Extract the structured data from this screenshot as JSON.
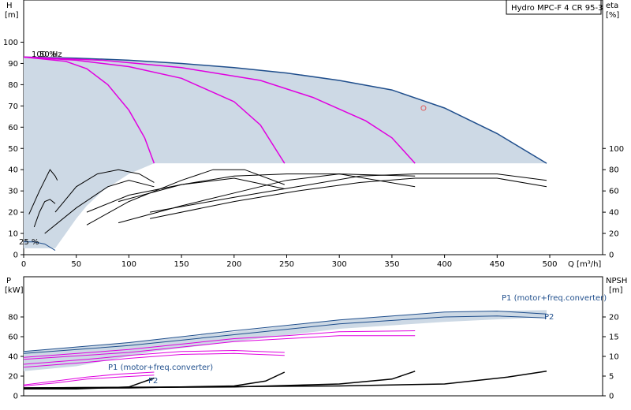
{
  "title": "Hydro MPC-F 4 CR 95-3",
  "chart_data": [
    {
      "type": "line",
      "panel": "head",
      "title": "Hydro MPC-F 4 CR 95-3",
      "x_axis": {
        "label": "Q [m³/h]",
        "range": [
          0,
          520
        ],
        "ticks": [
          0,
          50,
          100,
          150,
          200,
          250,
          300,
          350,
          400,
          450,
          500
        ]
      },
      "y_left": {
        "label_unit": "H",
        "label_bracket": "[m]",
        "range": [
          0,
          110
        ],
        "ticks": [
          0,
          10,
          20,
          30,
          40,
          50,
          60,
          70,
          80,
          90,
          100
        ]
      },
      "y_right": {
        "label_unit": "eta",
        "label_bracket": "[%]",
        "range_units": "eta %",
        "ticks": [
          0,
          20,
          40,
          60,
          80,
          100
        ],
        "eta_to_head_scale": 0.5
      },
      "annotations": {
        "speed_label": "100 %",
        "freq_label": "50 Hz",
        "min_speed_label": "25 %"
      },
      "operating_point": {
        "q": 380,
        "h": 69
      },
      "shaded_region": {
        "outline": [
          [
            0,
            93
          ],
          [
            50,
            92.5
          ],
          [
            100,
            91.5
          ],
          [
            150,
            90
          ],
          [
            200,
            88
          ],
          [
            250,
            85.5
          ],
          [
            300,
            82
          ],
          [
            350,
            77.5
          ],
          [
            400,
            69
          ],
          [
            450,
            57
          ],
          [
            497,
            43
          ],
          [
            497,
            43
          ],
          [
            200,
            43
          ],
          [
            124,
            43
          ],
          [
            100,
            38
          ],
          [
            75,
            30
          ],
          [
            60,
            23
          ],
          [
            50,
            17
          ],
          [
            40,
            10
          ],
          [
            30,
            3
          ],
          [
            0,
            3
          ],
          [
            0,
            93
          ]
        ],
        "color": "#cdd9e5"
      },
      "head_curves": [
        {
          "color": "#1f4e8c",
          "points": [
            [
              0,
              93
            ],
            [
              50,
              92.5
            ],
            [
              100,
              91.5
            ],
            [
              150,
              90
            ],
            [
              200,
              88
            ],
            [
              250,
              85.5
            ],
            [
              300,
              82
            ],
            [
              350,
              77.5
            ],
            [
              400,
              69
            ],
            [
              450,
              57
            ],
            [
              497,
              43
            ]
          ]
        },
        {
          "color": "#e000e0",
          "points": [
            [
              0,
              93
            ],
            [
              40,
              91
            ],
            [
              60,
              87.5
            ],
            [
              80,
              80
            ],
            [
              100,
              68
            ],
            [
              115,
              55
            ],
            [
              124,
              43
            ]
          ]
        },
        {
          "color": "#e000e0",
          "points": [
            [
              0,
              93
            ],
            [
              50,
              91.5
            ],
            [
              100,
              88.5
            ],
            [
              150,
              83
            ],
            [
              200,
              72
            ],
            [
              225,
              61
            ],
            [
              248,
              43
            ]
          ]
        },
        {
          "color": "#e000e0",
          "points": [
            [
              0,
              93
            ],
            [
              75,
              91.5
            ],
            [
              150,
              88
            ],
            [
              225,
              82
            ],
            [
              275,
              74
            ],
            [
              325,
              63
            ],
            [
              350,
              55
            ],
            [
              372,
              43
            ]
          ]
        }
      ],
      "eta_curves": [
        {
          "color": "#000000",
          "points": [
            [
              5,
              19
            ],
            [
              15,
              30
            ],
            [
              20,
              35
            ],
            [
              25,
              40
            ],
            [
              30,
              37
            ],
            [
              32,
              35
            ]
          ]
        },
        {
          "color": "#000000",
          "points": [
            [
              10,
              13
            ],
            [
              15,
              20
            ],
            [
              20,
              25
            ],
            [
              25,
              26
            ],
            [
              30,
              24
            ]
          ]
        },
        {
          "color": "#000000",
          "points": [
            [
              30,
              20
            ],
            [
              50,
              32
            ],
            [
              70,
              38
            ],
            [
              90,
              40
            ],
            [
              110,
              38
            ],
            [
              124,
              34
            ]
          ]
        },
        {
          "color": "#000000",
          "points": [
            [
              20,
              10
            ],
            [
              50,
              22
            ],
            [
              80,
              32
            ],
            [
              100,
              35
            ],
            [
              124,
              32
            ]
          ]
        },
        {
          "color": "#000000",
          "points": [
            [
              60,
              14
            ],
            [
              100,
              25
            ],
            [
              150,
              35
            ],
            [
              180,
              40
            ],
            [
              210,
              40
            ],
            [
              248,
              33
            ]
          ]
        },
        {
          "color": "#000000",
          "points": [
            [
              60,
              20
            ],
            [
              100,
              28
            ],
            [
              150,
              33
            ],
            [
              200,
              36
            ],
            [
              248,
              31
            ]
          ]
        },
        {
          "color": "#000000",
          "points": [
            [
              90,
              15
            ],
            [
              150,
              23
            ],
            [
              200,
              29
            ],
            [
              250,
              35
            ],
            [
              300,
              38
            ],
            [
              372,
              37
            ]
          ]
        },
        {
          "color": "#000000",
          "points": [
            [
              90,
              25
            ],
            [
              150,
              33
            ],
            [
              200,
              37
            ],
            [
              250,
              38
            ],
            [
              300,
              38
            ],
            [
              372,
              32
            ]
          ]
        },
        {
          "color": "#000000",
          "points": [
            [
              120,
              20
            ],
            [
              200,
              27
            ],
            [
              260,
              32
            ],
            [
              320,
              37
            ],
            [
              372,
              38
            ],
            [
              450,
              38
            ],
            [
              497,
              35
            ]
          ]
        },
        {
          "color": "#000000",
          "points": [
            [
              120,
              17
            ],
            [
              200,
              25
            ],
            [
              260,
              30
            ],
            [
              320,
              34
            ],
            [
              372,
              36
            ],
            [
              450,
              36
            ],
            [
              497,
              32
            ]
          ]
        }
      ],
      "min_curve": {
        "color": "#1f4e8c",
        "points": [
          [
            0,
            6
          ],
          [
            10,
            6
          ],
          [
            20,
            5
          ],
          [
            30,
            2
          ]
        ]
      }
    },
    {
      "type": "line",
      "panel": "power_npsh",
      "x_axis": {
        "range": [
          0,
          520
        ]
      },
      "y_left": {
        "label_unit": "P",
        "label_bracket": "[kW]",
        "range": [
          0,
          100
        ],
        "ticks": [
          0,
          20,
          40,
          60,
          80
        ]
      },
      "y_right": {
        "label_unit": "NPSH",
        "label_bracket": "[m]",
        "ticks": [
          0,
          5,
          10,
          15,
          20
        ],
        "npsh_to_kw_scale": 4
      },
      "labels": {
        "p1_high": "P1 (motor+freq.converter)",
        "p2_high": "P2",
        "p1_low": "P1 (motor+freq.converter)",
        "p2_low": "P2"
      },
      "shaded_region": {
        "outline": [
          [
            0,
            45
          ],
          [
            100,
            54
          ],
          [
            200,
            65
          ],
          [
            300,
            77
          ],
          [
            400,
            85
          ],
          [
            497,
            87
          ],
          [
            497,
            80
          ],
          [
            400,
            75
          ],
          [
            300,
            68
          ],
          [
            200,
            55
          ],
          [
            124,
            45
          ],
          [
            100,
            40
          ],
          [
            50,
            30
          ],
          [
            0,
            25
          ]
        ],
        "color": "#cdd9e5"
      },
      "power_curves": [
        {
          "color": "#1f4e8c",
          "points": [
            [
              0,
              45
            ],
            [
              100,
              54
            ],
            [
              200,
              66
            ],
            [
              300,
              77
            ],
            [
              400,
              85
            ],
            [
              450,
              86
            ],
            [
              497,
              83
            ]
          ]
        },
        {
          "color": "#1f4e8c",
          "points": [
            [
              0,
              43
            ],
            [
              100,
              51
            ],
            [
              200,
              62
            ],
            [
              300,
              73
            ],
            [
              400,
              80
            ],
            [
              450,
              81
            ],
            [
              497,
              79
            ]
          ]
        },
        {
          "color": "#e000e0",
          "points": [
            [
              0,
              39
            ],
            [
              100,
              47
            ],
            [
              200,
              58
            ],
            [
              250,
              61
            ],
            [
              300,
              65
            ],
            [
              372,
              66
            ]
          ]
        },
        {
          "color": "#e000e0",
          "points": [
            [
              0,
              37
            ],
            [
              100,
              44
            ],
            [
              200,
              55
            ],
            [
              250,
              58
            ],
            [
              300,
              61
            ],
            [
              372,
              61
            ]
          ]
        },
        {
          "color": "#e000e0",
          "points": [
            [
              0,
              32
            ],
            [
              60,
              37
            ],
            [
              100,
              41
            ],
            [
              150,
              45
            ],
            [
              200,
              46
            ],
            [
              248,
              44
            ]
          ]
        },
        {
          "color": "#e000e0",
          "points": [
            [
              0,
              29
            ],
            [
              60,
              34
            ],
            [
              100,
              38
            ],
            [
              150,
              42
            ],
            [
              200,
              43
            ],
            [
              248,
              41
            ]
          ]
        },
        {
          "color": "#e000e0",
          "points": [
            [
              0,
              11
            ],
            [
              30,
              15
            ],
            [
              60,
              19
            ],
            [
              90,
              22
            ],
            [
              124,
              24
            ]
          ]
        },
        {
          "color": "#e000e0",
          "points": [
            [
              0,
              10
            ],
            [
              30,
              13
            ],
            [
              60,
              17
            ],
            [
              90,
              19
            ],
            [
              124,
              21
            ]
          ]
        }
      ],
      "npsh_curves": [
        {
          "color": "#000000",
          "points": [
            [
              0,
              7
            ],
            [
              50,
              7
            ],
            [
              100,
              9
            ],
            [
              124,
              18
            ]
          ]
        },
        {
          "color": "#000000",
          "points": [
            [
              0,
              7.5
            ],
            [
              100,
              8
            ],
            [
              200,
              10
            ],
            [
              230,
              15
            ],
            [
              248,
              24
            ]
          ]
        },
        {
          "color": "#000000",
          "points": [
            [
              0,
              8
            ],
            [
              200,
              9
            ],
            [
              300,
              12
            ],
            [
              350,
              17
            ],
            [
              372,
              25
            ]
          ]
        },
        {
          "color": "#000000",
          "points": [
            [
              0,
              8
            ],
            [
              300,
              10
            ],
            [
              400,
              12
            ],
            [
              460,
              19
            ],
            [
              497,
              25
            ]
          ]
        }
      ]
    }
  ]
}
